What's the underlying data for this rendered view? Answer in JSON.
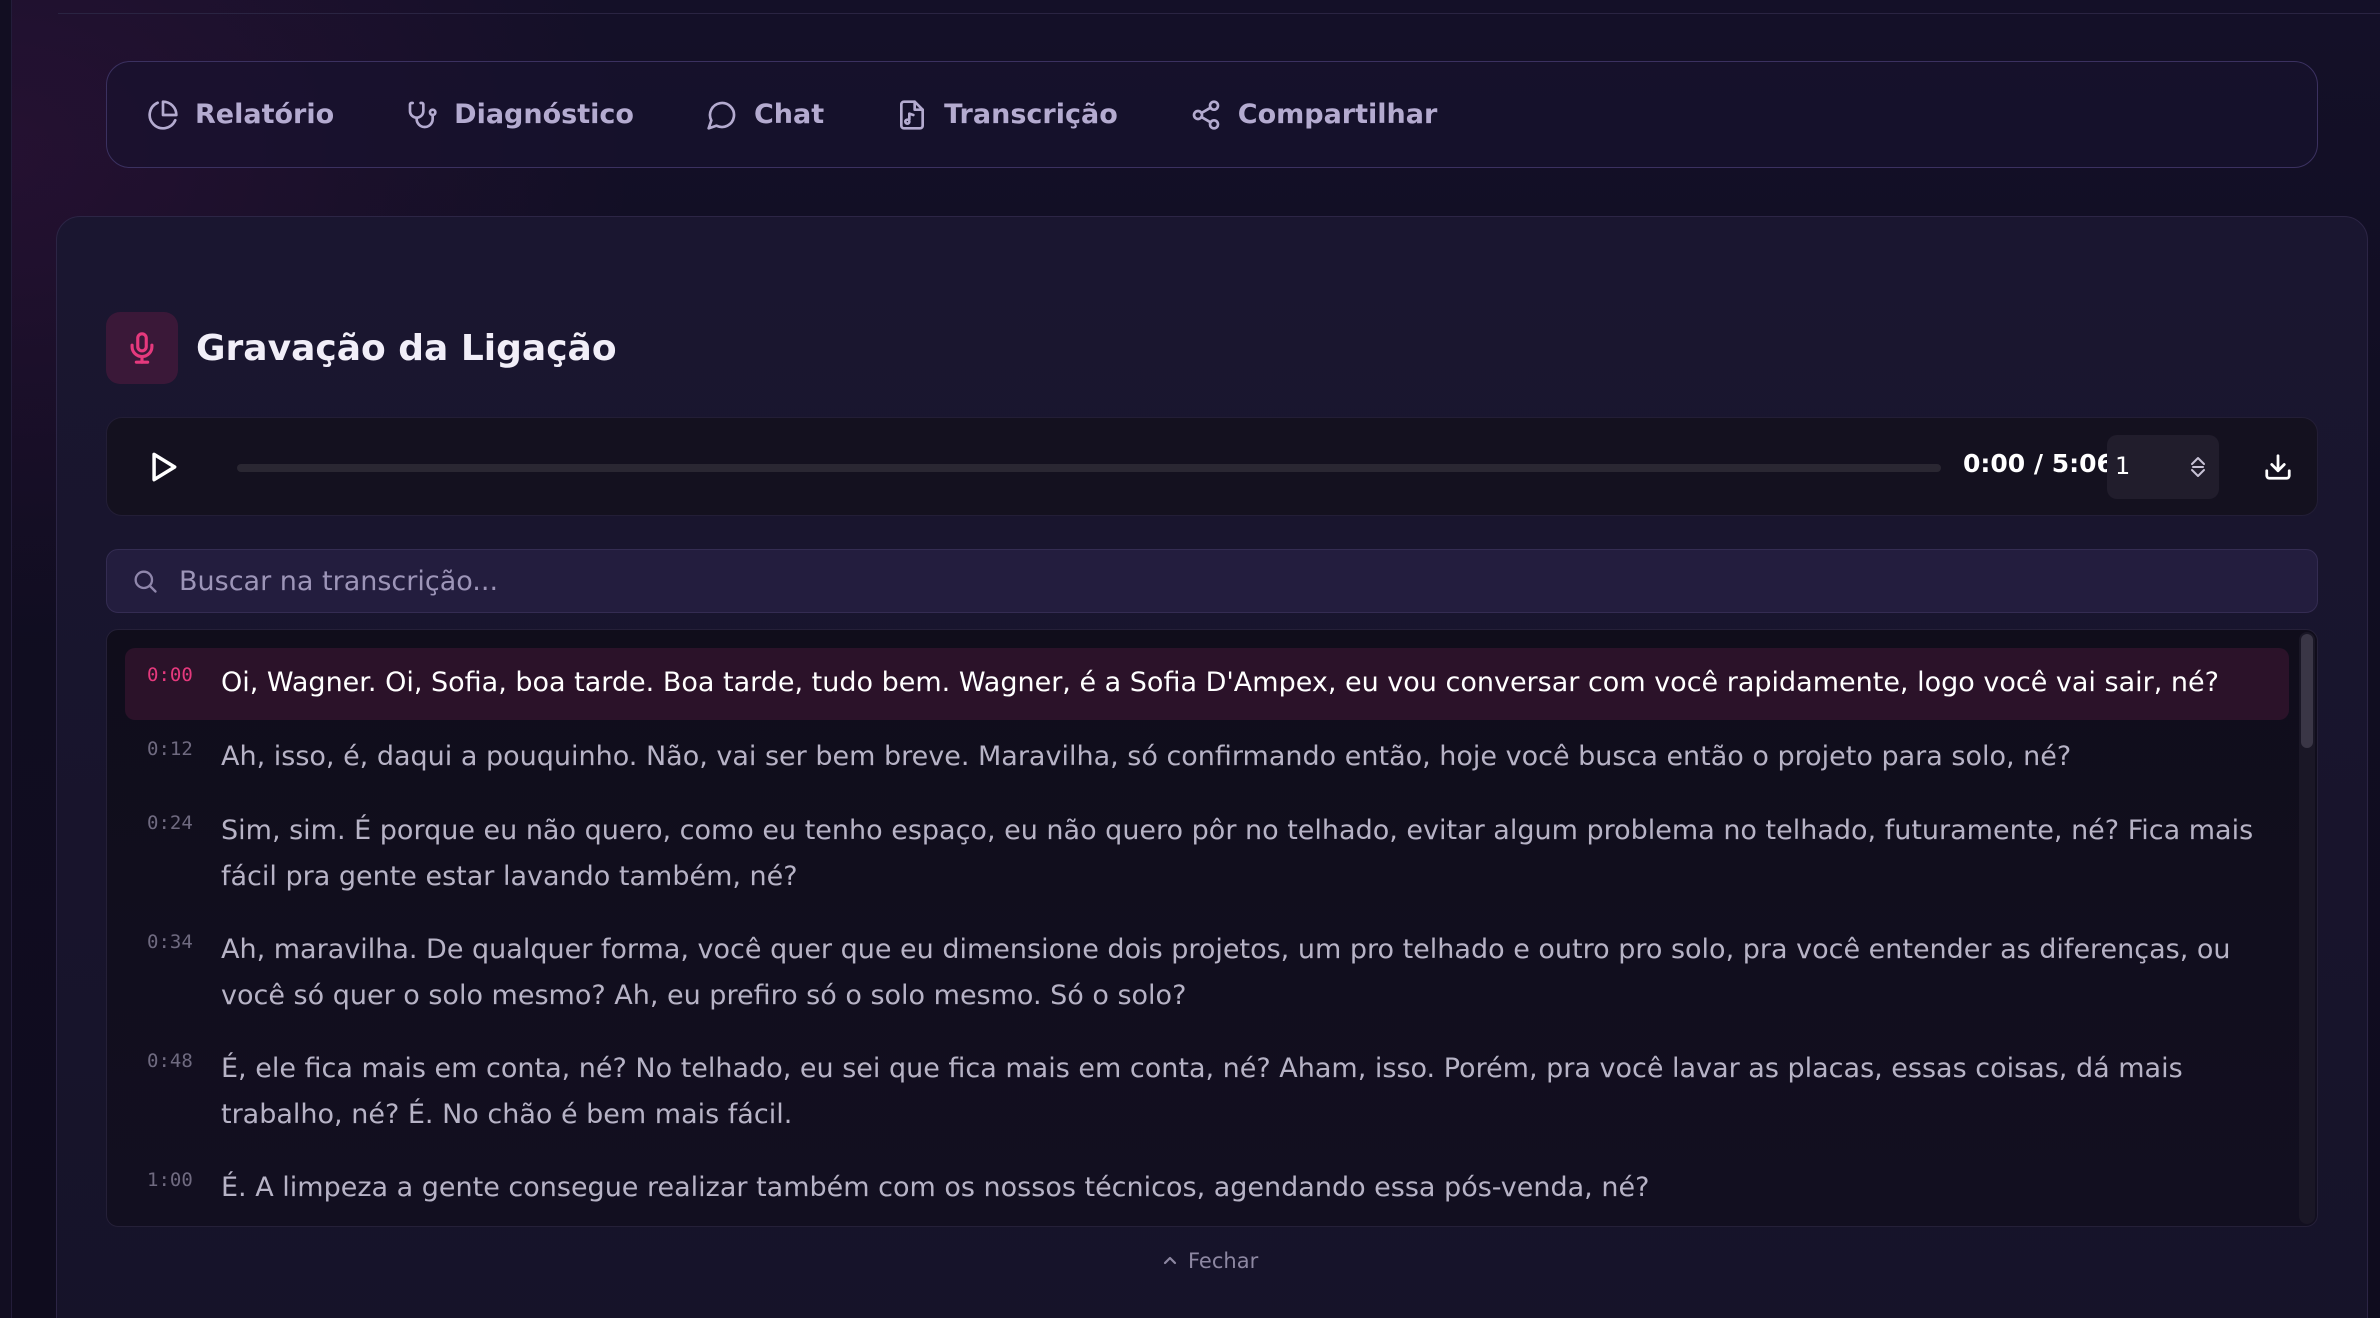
{
  "nav": {
    "items": [
      {
        "label": "Relatório",
        "icon": "pie-chart-icon"
      },
      {
        "label": "Diagnóstico",
        "icon": "stethoscope-icon"
      },
      {
        "label": "Chat",
        "icon": "message-circle-icon"
      },
      {
        "label": "Transcrição",
        "icon": "file-audio-icon"
      },
      {
        "label": "Compartilhar",
        "icon": "share-icon"
      }
    ]
  },
  "recording": {
    "title": "Gravação da Ligação",
    "icon": "microphone-icon"
  },
  "player": {
    "time": "0:00 / 5:06",
    "playback_rate": "1",
    "progress": 0
  },
  "search": {
    "placeholder": "Buscar na transcrição..."
  },
  "transcript": {
    "segments": [
      {
        "timestamp": "0:00",
        "text": "Oi, Wagner. Oi, Sofia, boa tarde. Boa tarde, tudo bem. Wagner, é a Sofia D'Ampex, eu vou conversar com você rapidamente, logo você vai sair, né?",
        "active": true
      },
      {
        "timestamp": "0:12",
        "text": "Ah, isso, é, daqui a pouquinho. Não, vai ser bem breve. Maravilha, só confirmando então, hoje você busca então o projeto para solo, né?",
        "active": false
      },
      {
        "timestamp": "0:24",
        "text": "Sim, sim. É porque eu não quero, como eu tenho espaço, eu não quero pôr no telhado, evitar algum problema no telhado, futuramente, né? Fica mais fácil pra gente estar lavando também, né?",
        "active": false
      },
      {
        "timestamp": "0:34",
        "text": "Ah, maravilha. De qualquer forma, você quer que eu dimensione dois projetos, um pro telhado e outro pro solo, pra você entender as diferenças, ou você só quer o solo mesmo? Ah, eu prefiro só o solo mesmo. Só o solo?",
        "active": false
      },
      {
        "timestamp": "0:48",
        "text": "É, ele fica mais em conta, né? No telhado, eu sei que fica mais em conta, né? Aham, isso. Porém, pra você lavar as placas, essas coisas, dá mais trabalho, né? É. No chão é bem mais fácil.",
        "active": false
      },
      {
        "timestamp": "1:00",
        "text": "É. A limpeza a gente consegue realizar também com os nossos técnicos, agendando essa pós-venda, né?",
        "active": false
      }
    ]
  },
  "footer": {
    "close_label": "Fechar"
  },
  "colors": {
    "accent": "#e5397d",
    "background": "#0f0c1f",
    "active_row": "#2b1229"
  }
}
